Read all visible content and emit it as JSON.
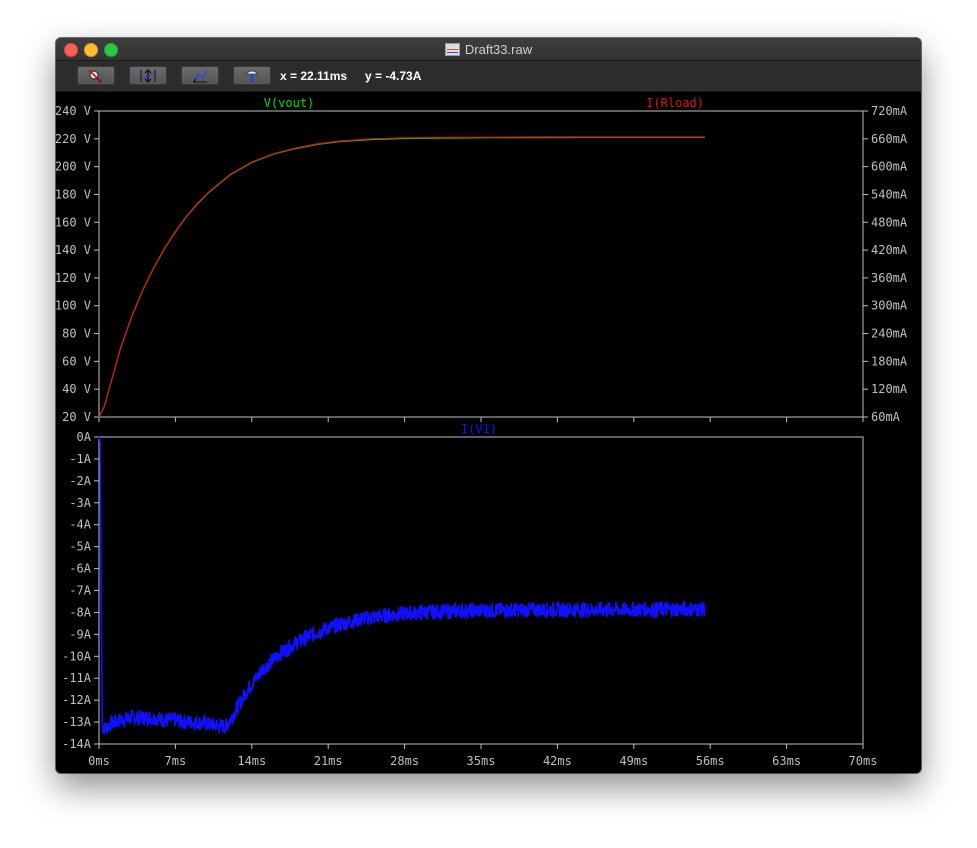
{
  "window": {
    "title": "Draft33.raw"
  },
  "toolbar": {
    "buttons": [
      {
        "name": "zoom-cancel-button",
        "icon": "magnifier-cancel-icon"
      },
      {
        "name": "autorange-y-button",
        "icon": "autorange-y-icon"
      },
      {
        "name": "autorange-x-button",
        "icon": "autorange-x-icon"
      },
      {
        "name": "probe-button",
        "icon": "probe-icon"
      }
    ],
    "x_readout": "x = 22.11ms",
    "y_readout": "y = -4.73A"
  },
  "colors": {
    "vout": "#00e000",
    "iload": "#e01010",
    "iv1": "#1010ff",
    "axis": "#c0c0c0",
    "background": "#000000"
  },
  "chart_data": [
    {
      "type": "line",
      "title": "",
      "x_tick_labels": [
        "0ms",
        "7ms",
        "14ms",
        "21ms",
        "28ms",
        "35ms",
        "42ms",
        "49ms",
        "56ms",
        "63ms",
        "70ms"
      ],
      "xlim": [
        0,
        70
      ],
      "x_unit": "ms",
      "left_axis": {
        "ylim": [
          20,
          240
        ],
        "tick_values": [
          20,
          40,
          60,
          80,
          100,
          120,
          140,
          160,
          180,
          200,
          220,
          240
        ],
        "tick_labels": [
          "20 V",
          "40 V",
          "60 V",
          "80 V",
          "100 V",
          "120 V",
          "140 V",
          "160 V",
          "180 V",
          "200 V",
          "220 V",
          "240 V"
        ]
      },
      "right_axis": {
        "ylim": [
          60,
          720
        ],
        "tick_values": [
          60,
          120,
          180,
          240,
          300,
          360,
          420,
          480,
          540,
          600,
          660,
          720
        ],
        "tick_labels": [
          "60mA",
          "120mA",
          "180mA",
          "240mA",
          "300mA",
          "360mA",
          "420mA",
          "480mA",
          "540mA",
          "600mA",
          "660mA",
          "720mA"
        ]
      },
      "series": [
        {
          "name": "V(vout)",
          "axis": "left",
          "color": "#00e000",
          "x": [
            0,
            0.5,
            1,
            2,
            3,
            4,
            5,
            6,
            7,
            8,
            9,
            10,
            12,
            14,
            16,
            18,
            20,
            22,
            25,
            28,
            32,
            36,
            40,
            45,
            50,
            55.5
          ],
          "y": [
            20,
            28,
            42,
            70,
            92,
            111,
            127,
            141,
            153,
            164,
            173,
            181,
            194,
            203,
            209,
            213,
            216,
            218,
            219.5,
            220.2,
            220.6,
            220.8,
            220.9,
            221,
            221,
            221
          ]
        },
        {
          "name": "I(Rload)",
          "axis": "right",
          "color": "#e01010",
          "x": [
            0,
            0.5,
            1,
            2,
            3,
            4,
            5,
            6,
            7,
            8,
            9,
            10,
            12,
            14,
            16,
            18,
            20,
            22,
            25,
            28,
            32,
            36,
            40,
            45,
            50,
            55.5
          ],
          "y": [
            60,
            84,
            127,
            211,
            277,
            334,
            382,
            424,
            460,
            493,
            520,
            544,
            583,
            610,
            628,
            640,
            649,
            655,
            660,
            662,
            663,
            663.5,
            664,
            664,
            664,
            664
          ]
        }
      ]
    },
    {
      "type": "line",
      "title": "",
      "x_tick_labels": [
        "0ms",
        "7ms",
        "14ms",
        "21ms",
        "28ms",
        "35ms",
        "42ms",
        "49ms",
        "56ms",
        "63ms",
        "70ms"
      ],
      "xlim": [
        0,
        70
      ],
      "x_unit": "ms",
      "left_axis": {
        "ylim": [
          -14,
          0
        ],
        "tick_values": [
          0,
          -1,
          -2,
          -3,
          -4,
          -5,
          -6,
          -7,
          -8,
          -9,
          -10,
          -11,
          -12,
          -13,
          -14
        ],
        "tick_labels": [
          "0A",
          "-1A",
          "-2A",
          "-3A",
          "-4A",
          "-5A",
          "-6A",
          "-7A",
          "-8A",
          "-9A",
          "-10A",
          "-11A",
          "-12A",
          "-13A",
          "-14A"
        ]
      },
      "series": [
        {
          "name": "I(V1)",
          "axis": "left",
          "color": "#1010ff",
          "noise_amplitude": 0.35,
          "x": [
            0,
            0.1,
            0.3,
            0.6,
            1,
            2,
            3,
            4,
            5,
            6,
            7,
            8,
            9,
            10,
            11,
            11.6,
            12.5,
            13.5,
            15,
            16.5,
            18,
            20,
            22,
            24,
            26,
            28,
            30,
            33,
            36,
            40,
            45,
            50,
            55.5
          ],
          "y": [
            0,
            -0.2,
            -13.2,
            -13.3,
            -13.1,
            -12.9,
            -12.8,
            -12.8,
            -12.8,
            -12.9,
            -12.9,
            -13.0,
            -13.0,
            -13.1,
            -13.15,
            -13.2,
            -12.5,
            -11.6,
            -10.6,
            -9.9,
            -9.4,
            -8.9,
            -8.55,
            -8.3,
            -8.15,
            -8.05,
            -7.98,
            -7.93,
            -7.9,
            -7.88,
            -7.87,
            -7.86,
            -7.85
          ]
        }
      ]
    }
  ]
}
